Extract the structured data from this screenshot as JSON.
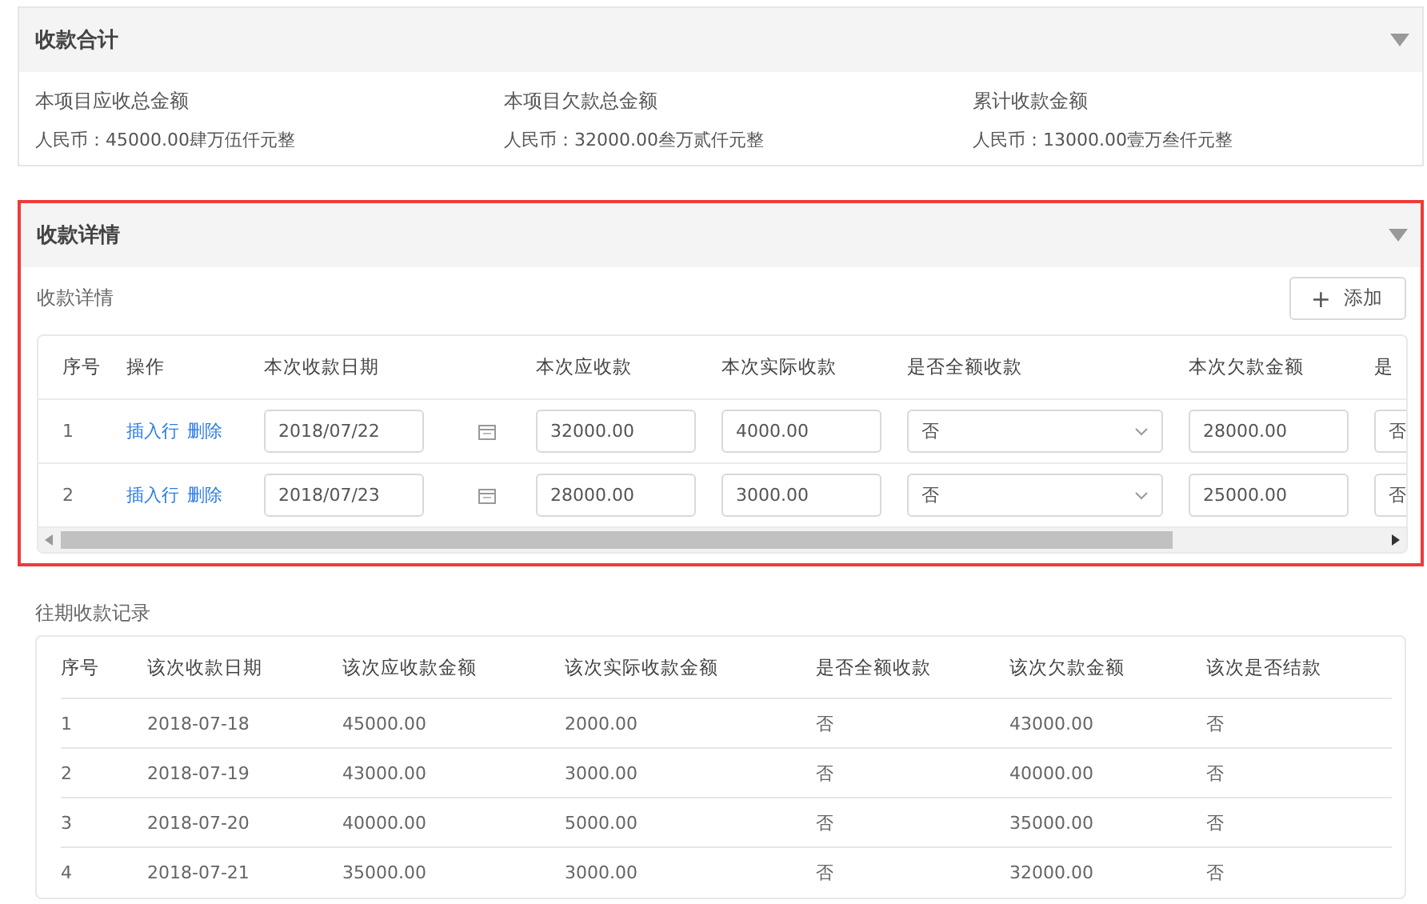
{
  "summary": {
    "title": "收款合计",
    "expanded": true,
    "items": [
      {
        "label": "本项目应收总金额",
        "value": "人民币：45000.00肆万伍仟元整"
      },
      {
        "label": "本项目欠款总金额",
        "value": "人民币：32000.00叁万贰仟元整"
      },
      {
        "label": "累计收款金额",
        "value": "人民币：13000.00壹万叁仟元整"
      }
    ]
  },
  "details": {
    "title": "收款详情",
    "expanded": true,
    "subtitle": "收款详情",
    "add_button": {
      "icon": "+",
      "label": "添加"
    },
    "columns": [
      "序号",
      "操作",
      "本次收款日期",
      "本次应收款",
      "本次实际收款",
      "是否全额收款",
      "本次欠款金额",
      "是"
    ],
    "rows": [
      {
        "index": "1",
        "actions": [
          "插入行",
          "删除"
        ],
        "date": "2018/07/22",
        "receivable": "32000.00",
        "actual": "4000.00",
        "full": "否",
        "arrears": "28000.00",
        "column_8": "否"
      },
      {
        "index": "2",
        "actions": [
          "插入行",
          "删除"
        ],
        "date": "2018/07/23",
        "receivable": "28000.00",
        "actual": "3000.00",
        "full": "否",
        "arrears": "25000.00",
        "column_8": "否"
      }
    ]
  },
  "history": {
    "title": "往期收款记录",
    "columns": [
      "序号",
      "该次收款日期",
      "该次应收款金额",
      "该次实际收款金额",
      "是否全额收款",
      "该次欠款金额",
      "该次是否结款"
    ],
    "rows": [
      [
        "1",
        "2018-07-18",
        "45000.00",
        "2000.00",
        "否",
        "43000.00",
        "否"
      ],
      [
        "2",
        "2018-07-19",
        "43000.00",
        "3000.00",
        "否",
        "40000.00",
        "否"
      ],
      [
        "3",
        "2018-07-20",
        "40000.00",
        "5000.00",
        "否",
        "35000.00",
        "否"
      ],
      [
        "4",
        "2018-07-21",
        "35000.00",
        "3000.00",
        "否",
        "32000.00",
        "否"
      ]
    ]
  }
}
